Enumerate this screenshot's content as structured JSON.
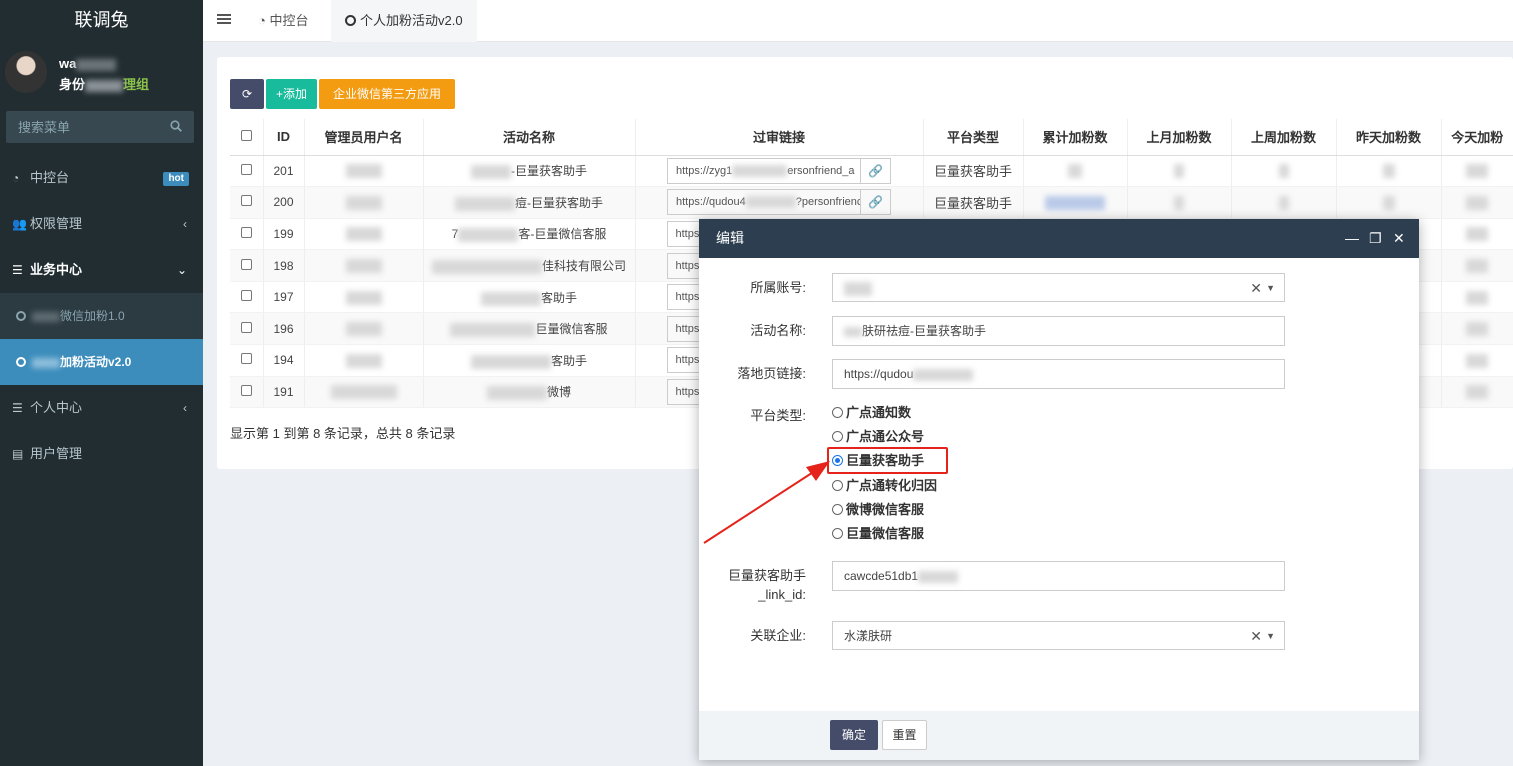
{
  "app": {
    "logo": "联调兔"
  },
  "user": {
    "name_prefix": "wa",
    "role_prefix": "身份",
    "role_suffix": "理组"
  },
  "sidebar": {
    "search_placeholder": "搜索菜单",
    "items": [
      {
        "label": "中控台",
        "badge": "hot",
        "icon": "dashboard-icon"
      },
      {
        "label": "权限管理",
        "icon": "users-icon"
      },
      {
        "label": "业务中心",
        "icon": "list-icon"
      },
      {
        "label": "个人中心",
        "icon": "list-icon"
      },
      {
        "label": "用户管理",
        "icon": "id-card-icon"
      }
    ],
    "sub_items": [
      {
        "label": "微信加粉1.0"
      },
      {
        "label": "加粉活动v2.0"
      }
    ]
  },
  "topbar": {
    "tabs": [
      {
        "label": "中控台",
        "icon": "dashboard-icon"
      },
      {
        "label": "个人加粉活动v2.0",
        "icon": "circle-icon"
      }
    ]
  },
  "toolbar": {
    "add_label": "+添加",
    "wx_label": "企业微信第三方应用"
  },
  "table": {
    "headers": [
      "ID",
      "管理员用户名",
      "活动名称",
      "过审链接",
      "平台类型",
      "累计加粉数",
      "上月加粉数",
      "上周加粉数",
      "昨天加粉数",
      "今天加粉"
    ],
    "rows": [
      {
        "id": "201",
        "name": "-巨量获客助手",
        "link": "https://zyg1",
        "link_tail": "ersonfriend_a",
        "platform": "巨量获客助手"
      },
      {
        "id": "200",
        "name": "痘-巨量获客助手",
        "link": "https://qudou4",
        "link_tail": "?personfrienc",
        "platform": "巨量获客助手"
      },
      {
        "id": "199",
        "name": "7",
        "name_tail": "客-巨量微信客服",
        "link": "https",
        "link_tail": "",
        "platform": ""
      },
      {
        "id": "198",
        "name": "",
        "name_tail": "佳科技有限公司",
        "link": "https",
        "link_tail": "",
        "platform": ""
      },
      {
        "id": "197",
        "name": "",
        "name_tail": "客助手",
        "link": "https",
        "link_tail": "",
        "platform": ""
      },
      {
        "id": "196",
        "name": "",
        "name_tail": "巨量微信客服",
        "link": "https",
        "link_tail": "",
        "platform": ""
      },
      {
        "id": "194",
        "name": "",
        "name_tail": "客助手",
        "link": "https",
        "link_tail": "",
        "platform": ""
      },
      {
        "id": "191",
        "name": "",
        "name_tail": "微博",
        "link": "https",
        "link_tail": "",
        "platform": ""
      }
    ],
    "pager": "显示第 1 到第 8 条记录，总共 8 条记录"
  },
  "modal": {
    "title": "编辑",
    "labels": {
      "account": "所属账号:",
      "activity": "活动名称:",
      "landing": "落地页链接:",
      "platform": "平台类型:",
      "link_id_1": "巨量获客助手",
      "link_id_2": "_link_id:",
      "company": "关联企业:"
    },
    "values": {
      "activity": "肤研祛痘-巨量获客助手",
      "landing": "https://qudou",
      "link_id": "cawcde51db1",
      "company": "水漾肤研"
    },
    "platform_options": [
      {
        "label": "广点通知数",
        "selected": false
      },
      {
        "label": "广点通公众号",
        "selected": false
      },
      {
        "label": "巨量获客助手",
        "selected": true
      },
      {
        "label": "广点通转化归因",
        "selected": false
      },
      {
        "label": "微博微信客服",
        "selected": false
      },
      {
        "label": "巨量微信客服",
        "selected": false
      }
    ],
    "ok_label": "确定",
    "reset_label": "重置"
  },
  "colors": {
    "accent": "#3c8dbc",
    "highlight": "#e6231b",
    "modal_header": "#2c3e50",
    "add": "#18bc9c",
    "wx": "#f39c12"
  }
}
